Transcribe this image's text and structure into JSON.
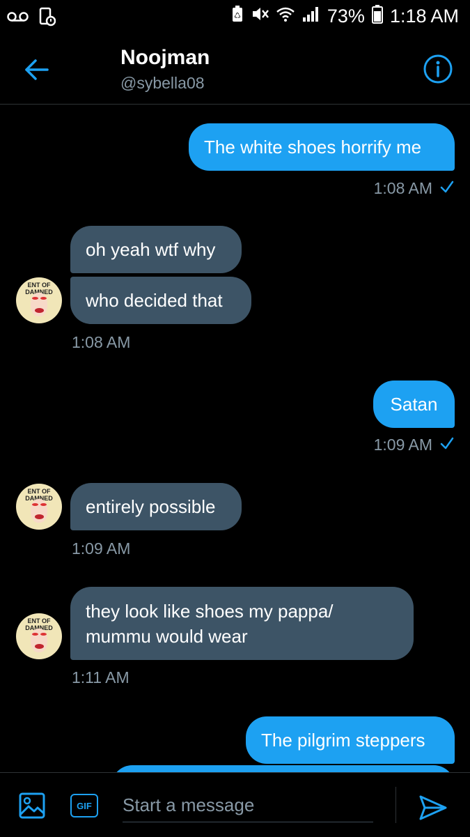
{
  "status_bar": {
    "battery_percent": "73%",
    "time": "1:18 AM",
    "icons": [
      "voicemail-icon",
      "app-icon",
      "battery-saver-icon",
      "mute-icon",
      "wifi-icon",
      "signal-icon",
      "battery-icon"
    ]
  },
  "header": {
    "name": "Noojman",
    "handle": "@sybella08",
    "back_icon": "back-arrow-icon",
    "info_icon": "info-icon"
  },
  "avatar_text": "ENT OF DAMNED",
  "messages": [
    {
      "direction": "out",
      "text": "The white shoes horrify me",
      "time": "1:08 AM",
      "status": "sent-check"
    },
    {
      "direction": "in",
      "text": "oh yeah wtf why"
    },
    {
      "direction": "in",
      "text": "who decided that",
      "time": "1:08 AM"
    },
    {
      "direction": "out",
      "text": "Satan",
      "time": "1:09 AM",
      "status": "sent-check"
    },
    {
      "direction": "in",
      "text": "entirely possible",
      "time": "1:09 AM"
    },
    {
      "direction": "in",
      "text": "they look like shoes my pappa/ mummu would wear",
      "time": "1:11 AM"
    },
    {
      "direction": "out",
      "text": "The pilgrim steppers"
    }
  ],
  "composer": {
    "placeholder": "Start a message",
    "gif_label": "GIF",
    "image_icon": "image-icon",
    "send_icon": "send-icon"
  },
  "colors": {
    "accent": "#1da1f2",
    "incoming_bubble": "#3d5466",
    "background": "#000000",
    "muted_text": "#8899a6"
  }
}
